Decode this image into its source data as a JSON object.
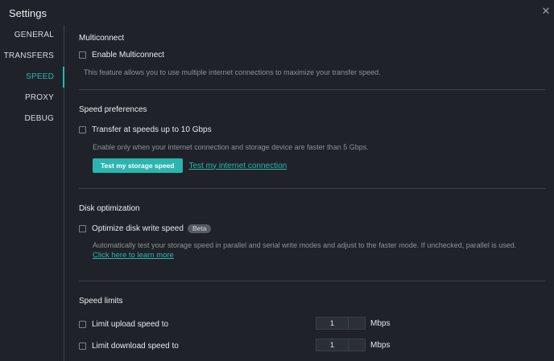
{
  "window": {
    "title": "Settings",
    "close_icon": "close-icon"
  },
  "sidebar": {
    "items": [
      {
        "label": "GENERAL",
        "active": false
      },
      {
        "label": "TRANSFERS",
        "active": false
      },
      {
        "label": "SPEED",
        "active": true
      },
      {
        "label": "PROXY",
        "active": false
      },
      {
        "label": "DEBUG",
        "active": false
      }
    ]
  },
  "multiconnect": {
    "title": "Multiconnect",
    "checkbox_label": "Enable Multiconnect",
    "description": "This feature allows you to use multiple internet connections to maximize your transfer speed."
  },
  "speed_preferences": {
    "title": "Speed preferences",
    "checkbox_label": "Transfer at speeds up to 10 Gbps",
    "description": "Enable only when your internet connection and storage device are faster than 5 Gbps.",
    "test_storage_button": "Test my storage speed",
    "test_internet_link": "Test my internet connection"
  },
  "disk_optimization": {
    "title": "Disk optimization",
    "checkbox_label": "Optimize disk write speed",
    "badge": "Beta",
    "description": "Automatically test your storage speed in parallel and serial write modes and adjust to the faster mode. If unchecked, parallel is used.",
    "learn_more_link": "Click here to learn more"
  },
  "speed_limits": {
    "title": "Speed limits",
    "upload": {
      "label": "Limit upload speed to",
      "value": "1",
      "unit": "Mbps"
    },
    "download": {
      "label": "Limit download speed to",
      "value": "1",
      "unit": "Mbps"
    }
  },
  "colors": {
    "accent": "#2bb5b1",
    "background": "#1f2329"
  }
}
